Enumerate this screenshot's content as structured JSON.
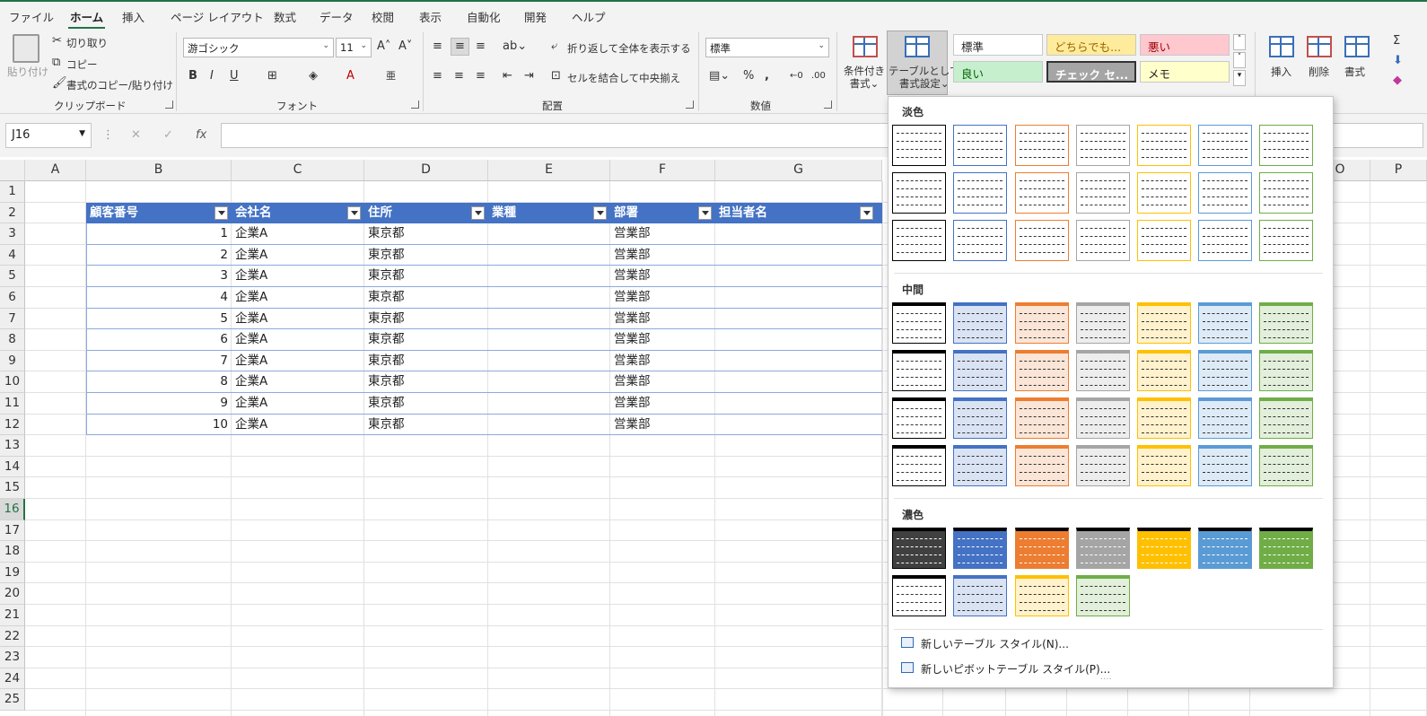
{
  "tabs": [
    "ファイル",
    "ホーム",
    "挿入",
    "ページ レイアウト",
    "数式",
    "データ",
    "校閲",
    "表示",
    "自動化",
    "開発",
    "ヘルプ"
  ],
  "ribbon": {
    "clipboard": {
      "paste": "貼り付け",
      "cut": "切り取り",
      "copy": "コピー",
      "format_painter": "書式のコピー/貼り付け",
      "group": "クリップボード"
    },
    "font": {
      "name": "游ゴシック",
      "size": "11",
      "group": "フォント"
    },
    "alignment": {
      "wrap": "折り返して全体を表示する",
      "merge": "セルを結合して中央揃え",
      "group": "配置"
    },
    "number": {
      "format": "標準",
      "group": "数値"
    },
    "styles": {
      "conditional": [
        "条件付き",
        "書式"
      ],
      "table_format": [
        "テーブルとして",
        "書式設定"
      ],
      "cells": [
        {
          "label": "標準",
          "bg": "#ffffff",
          "fg": "#222222"
        },
        {
          "label": "どちらでも...",
          "bg": "#ffeb9c",
          "fg": "#9c6500"
        },
        {
          "label": "悪い",
          "bg": "#ffc7ce",
          "fg": "#9c0006"
        },
        {
          "label": "良い",
          "bg": "#c6efce",
          "fg": "#006100"
        },
        {
          "label": "チェック セ...",
          "bg": "#a5a5a5",
          "fg": "#ffffff"
        },
        {
          "label": "メモ",
          "bg": "#ffffcc",
          "fg": "#222222"
        }
      ]
    },
    "cells": {
      "insert": "挿入",
      "delete": "削除",
      "format": "書式"
    }
  },
  "formula_bar": {
    "name_box": "J16",
    "fx": "fx"
  },
  "columns": [
    "A",
    "B",
    "C",
    "D",
    "E",
    "F",
    "G",
    "O",
    "P"
  ],
  "rows": [
    "1",
    "2",
    "3",
    "4",
    "5",
    "6",
    "7",
    "8",
    "9",
    "10",
    "11",
    "12",
    "13",
    "14",
    "15",
    "16",
    "17",
    "18",
    "19",
    "20",
    "21",
    "22",
    "23",
    "24",
    "25"
  ],
  "table": {
    "headers": [
      "顧客番号",
      "会社名",
      "住所",
      "業種",
      "部署",
      "担当者名"
    ],
    "rows": [
      [
        "1",
        "企業A",
        "東京都",
        "",
        "営業部",
        ""
      ],
      [
        "2",
        "企業A",
        "東京都",
        "",
        "営業部",
        ""
      ],
      [
        "3",
        "企業A",
        "東京都",
        "",
        "営業部",
        ""
      ],
      [
        "4",
        "企業A",
        "東京都",
        "",
        "営業部",
        ""
      ],
      [
        "5",
        "企業A",
        "東京都",
        "",
        "営業部",
        ""
      ],
      [
        "6",
        "企業A",
        "東京都",
        "",
        "営業部",
        ""
      ],
      [
        "7",
        "企業A",
        "東京都",
        "",
        "営業部",
        ""
      ],
      [
        "8",
        "企業A",
        "東京都",
        "",
        "営業部",
        ""
      ],
      [
        "9",
        "企業A",
        "東京都",
        "",
        "営業部",
        ""
      ],
      [
        "10",
        "企業A",
        "東京都",
        "",
        "営業部",
        ""
      ]
    ]
  },
  "dropdown": {
    "sections": [
      "淡色",
      "中間",
      "濃色"
    ],
    "colors": [
      "#000000",
      "#4472c4",
      "#ed7d31",
      "#a5a5a5",
      "#ffc000",
      "#5b9bd5",
      "#70ad47"
    ],
    "menu": [
      "新しいテーブル スタイル(N)...",
      "新しいピボットテーブル スタイル(P)..."
    ]
  }
}
